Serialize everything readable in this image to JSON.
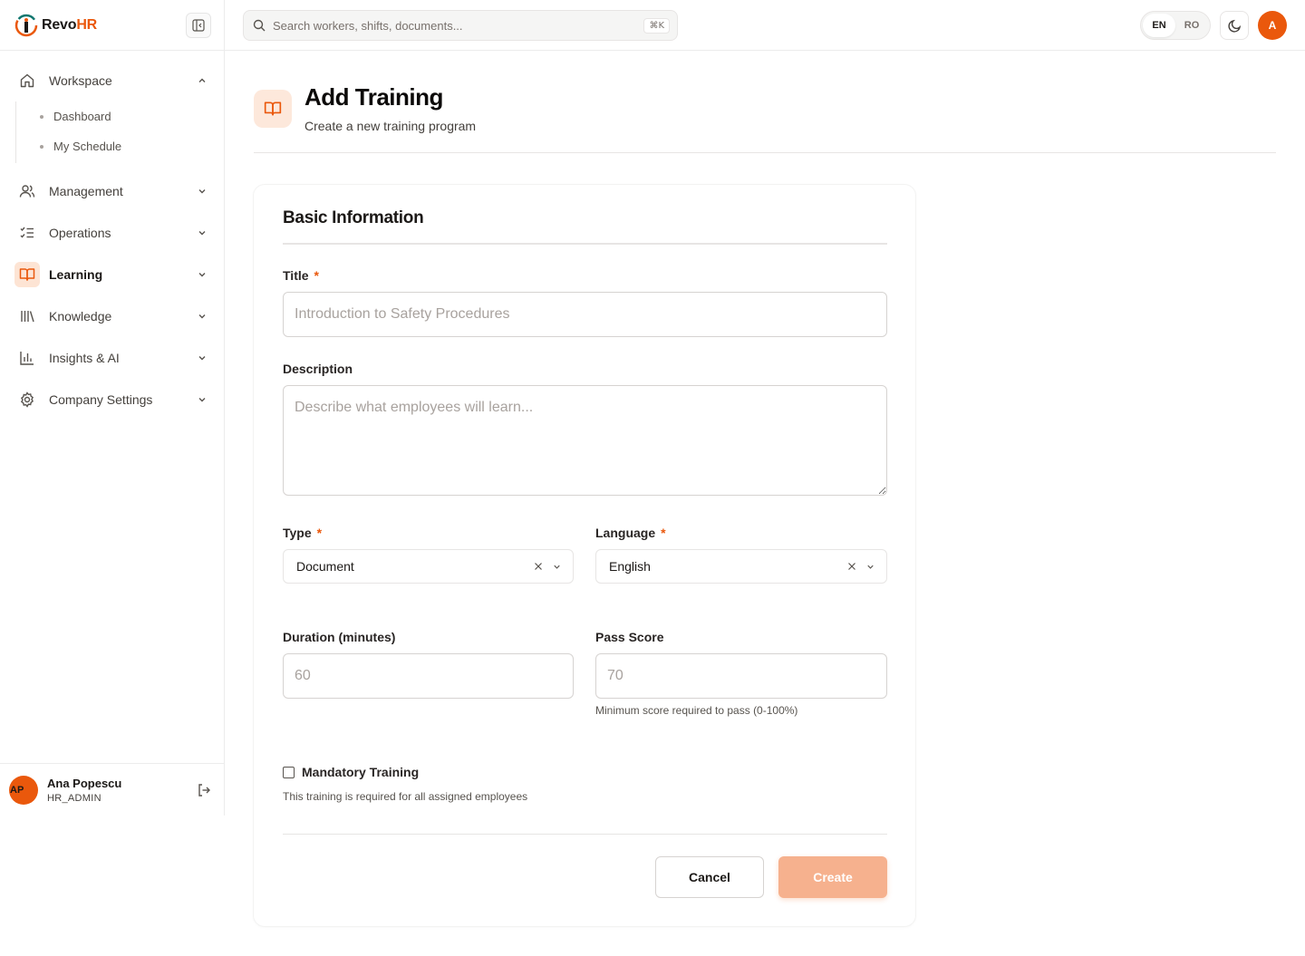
{
  "app": {
    "brand_prefix": "Revo",
    "brand_suffix": "HR",
    "accent_color": "#ea580c"
  },
  "sidebar": {
    "items": [
      {
        "label": "Workspace",
        "icon": "home-icon",
        "expanded": true,
        "children": [
          "Dashboard",
          "My Schedule"
        ]
      },
      {
        "label": "Management",
        "icon": "users-icon"
      },
      {
        "label": "Operations",
        "icon": "list-checks-icon"
      },
      {
        "label": "Learning",
        "icon": "book-open-icon",
        "active": true
      },
      {
        "label": "Knowledge",
        "icon": "library-icon"
      },
      {
        "label": "Insights & AI",
        "icon": "bar-chart-icon"
      },
      {
        "label": "Company Settings",
        "icon": "gear-icon"
      }
    ],
    "user": {
      "initials": "AP",
      "name": "Ana Popescu",
      "role": "HR_ADMIN"
    }
  },
  "topbar": {
    "search_placeholder": "Search workers, shifts, documents...",
    "search_shortcut": "⌘K",
    "languages": [
      "EN",
      "RO"
    ],
    "selected_language": "EN",
    "avatar_initial": "A"
  },
  "page": {
    "title": "Add Training",
    "subtitle": "Create a new training program"
  },
  "form": {
    "section_title": "Basic Information",
    "title_label": "Title",
    "title_placeholder": "Introduction to Safety Procedures",
    "description_label": "Description",
    "description_placeholder": "Describe what employees will learn...",
    "type_label": "Type",
    "type_value": "Document",
    "language_label": "Language",
    "language_value": "English",
    "duration_label": "Duration (minutes)",
    "duration_placeholder": "60",
    "pass_score_label": "Pass Score",
    "pass_score_placeholder": "70",
    "pass_score_hint": "Minimum score required to pass (0-100%)",
    "required_mark": "*",
    "mandatory_label": "Mandatory Training",
    "mandatory_checked": false,
    "mandatory_hint": "This training is required for all assigned employees",
    "cancel_label": "Cancel",
    "create_label": "Create"
  }
}
